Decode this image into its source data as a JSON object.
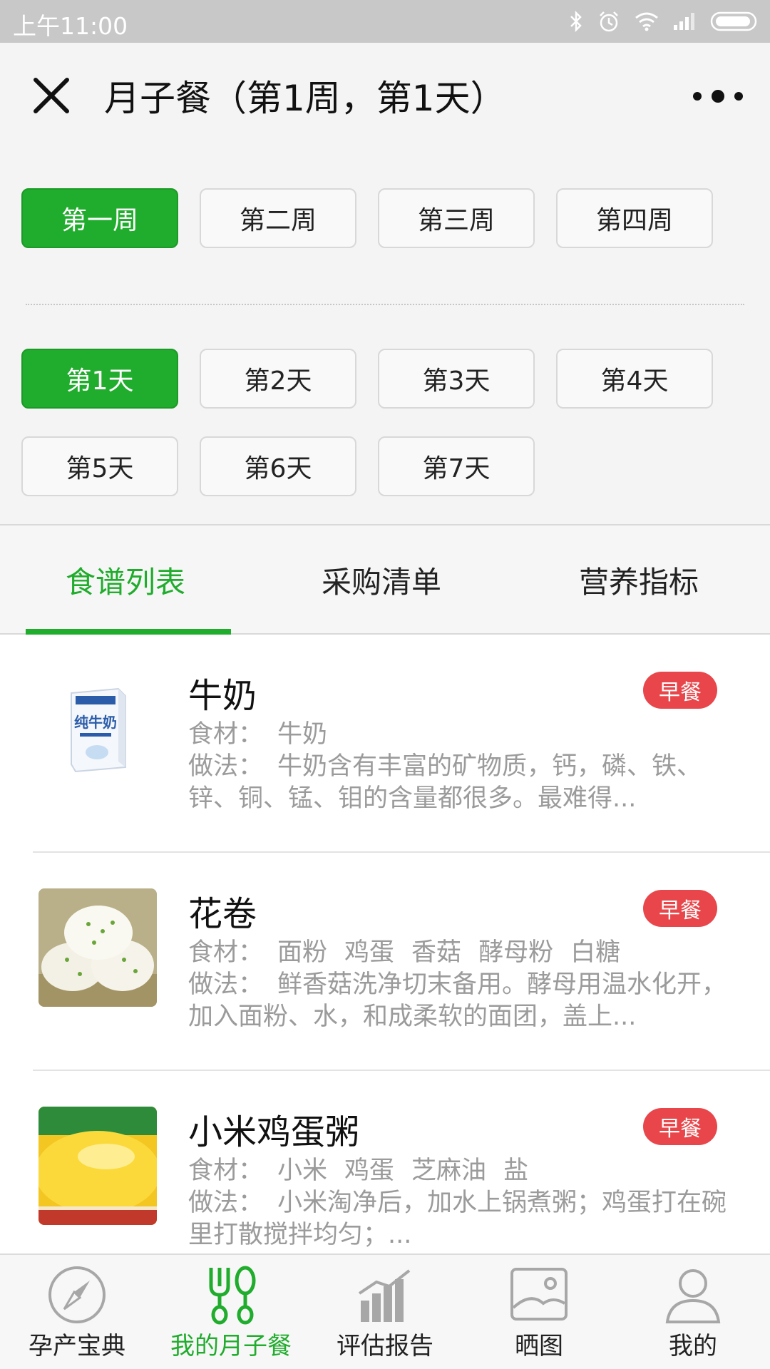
{
  "status_bar": {
    "time": "上午11:00"
  },
  "header": {
    "title": "月子餐（第1周，第1天）"
  },
  "weeks": [
    {
      "label": "第一周",
      "active": true
    },
    {
      "label": "第二周",
      "active": false
    },
    {
      "label": "第三周",
      "active": false
    },
    {
      "label": "第四周",
      "active": false
    }
  ],
  "days": [
    {
      "label": "第1天",
      "active": true
    },
    {
      "label": "第2天",
      "active": false
    },
    {
      "label": "第3天",
      "active": false
    },
    {
      "label": "第4天",
      "active": false
    },
    {
      "label": "第5天",
      "active": false
    },
    {
      "label": "第6天",
      "active": false
    },
    {
      "label": "第7天",
      "active": false
    }
  ],
  "tabs": [
    {
      "label": "食谱列表",
      "active": true
    },
    {
      "label": "采购清单",
      "active": false
    },
    {
      "label": "营养指标",
      "active": false
    }
  ],
  "recipe_labels": {
    "ingredients": "食材：",
    "method": "做法："
  },
  "recipes": [
    {
      "name": "牛奶",
      "meal": "早餐",
      "image": "milk-carton-photo",
      "image_text": "纯牛奶",
      "ingredients": [
        "牛奶"
      ],
      "method": "牛奶含有丰富的矿物质，钙，磷、铁、锌、铜、锰、钼的含量都很多。最难得..."
    },
    {
      "name": "花卷",
      "meal": "早餐",
      "image": "steamed-rolls-photo",
      "ingredients": [
        "面粉",
        "鸡蛋",
        "香菇",
        "酵母粉",
        "白糖"
      ],
      "method": "鲜香菇洗净切末备用。酵母用温水化开，加入面粉、水，和成柔软的面团，盖上..."
    },
    {
      "name": "小米鸡蛋粥",
      "meal": "早餐",
      "image": "millet-porridge-photo",
      "ingredients": [
        "小米",
        "鸡蛋",
        "芝麻油",
        "盐"
      ],
      "method": "小米淘净后，加水上锅煮粥；鸡蛋打在碗里打散搅拌均匀；..."
    }
  ],
  "bottom_nav": [
    {
      "label": "孕产宝典",
      "icon": "compass-icon",
      "active": false
    },
    {
      "label": "我的月子餐",
      "icon": "fork-spoon-icon",
      "active": true
    },
    {
      "label": "评估报告",
      "icon": "bar-chart-icon",
      "active": false
    },
    {
      "label": "晒图",
      "icon": "picture-icon",
      "active": false
    },
    {
      "label": "我的",
      "icon": "person-icon",
      "active": false
    }
  ],
  "colors": {
    "accent": "#20ac2c",
    "badge": "#e8464a",
    "muted_text": "#9b9b9b"
  }
}
